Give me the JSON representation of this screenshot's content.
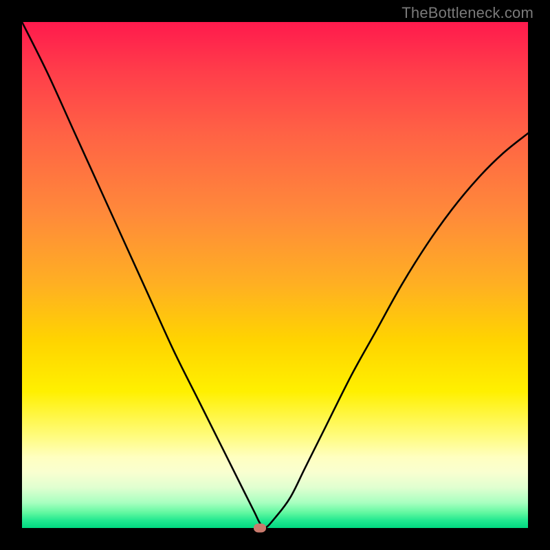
{
  "watermark": "TheBottleneck.com",
  "chart_data": {
    "type": "line",
    "title": "",
    "xlabel": "",
    "ylabel": "",
    "xlim": [
      0,
      100
    ],
    "ylim": [
      0,
      100
    ],
    "grid": false,
    "legend": false,
    "series": [
      {
        "name": "bottleneck-curve",
        "x": [
          0,
          5,
          10,
          15,
          20,
          25,
          30,
          35,
          40,
          44,
          46,
          47,
          48,
          50,
          53,
          56,
          60,
          65,
          70,
          75,
          80,
          85,
          90,
          95,
          100
        ],
        "values": [
          100,
          90,
          79,
          68,
          57,
          46,
          35,
          25,
          15,
          7,
          3,
          1,
          0,
          2,
          6,
          12,
          20,
          30,
          39,
          48,
          56,
          63,
          69,
          74,
          78
        ]
      }
    ],
    "marker": {
      "x": 47,
      "y": 0,
      "color": "#c97a6d"
    },
    "background_gradient": {
      "stops": [
        {
          "pos": 0,
          "color": "#ff1a4d"
        },
        {
          "pos": 0.5,
          "color": "#ffb022"
        },
        {
          "pos": 0.73,
          "color": "#fff000"
        },
        {
          "pos": 0.92,
          "color": "#e0ffd0"
        },
        {
          "pos": 1.0,
          "color": "#00d880"
        }
      ]
    }
  }
}
